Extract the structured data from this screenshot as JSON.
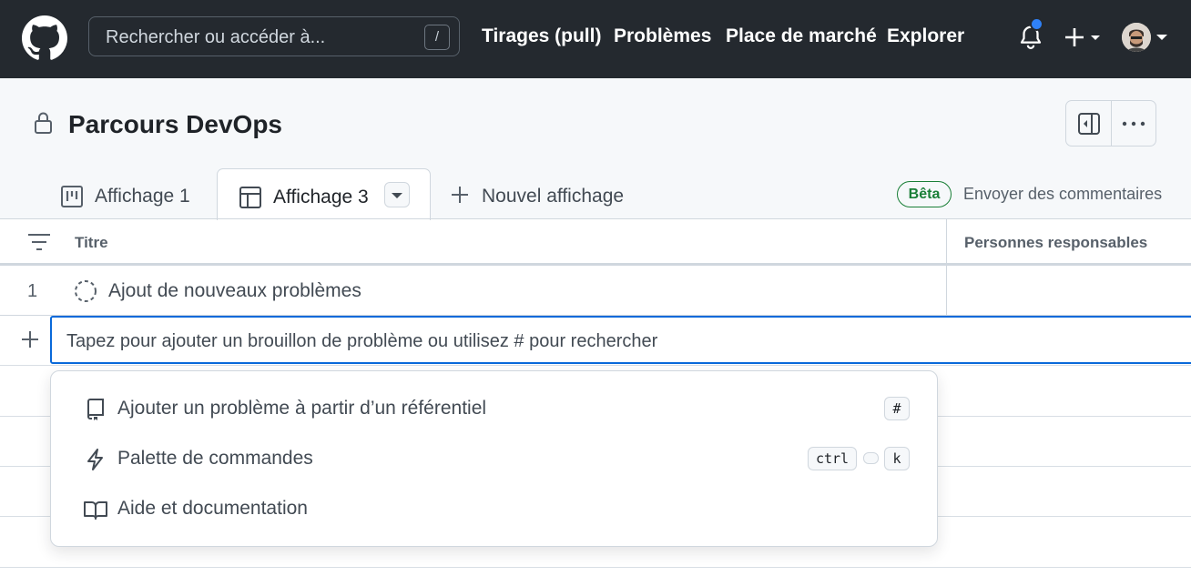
{
  "header": {
    "logo": "github-logo",
    "search_placeholder": "Rechercher ou accéder à...",
    "search_shortcut": "/",
    "nav": [
      "Tirages (pull)",
      "Problèmes",
      "Place de marché",
      "Explorer"
    ],
    "notification_color": "#2f81f7"
  },
  "project": {
    "title": "Parcours DevOps",
    "visibility_icon": "lock-icon"
  },
  "tabs": [
    {
      "label": "Affichage 1",
      "icon": "board-icon",
      "active": false
    },
    {
      "label": "Affichage 3",
      "icon": "table-icon",
      "active": true
    },
    {
      "label": "Nouvel affichage",
      "icon": "plus-icon",
      "active": false
    }
  ],
  "beta_label": "Bêta",
  "feedback_label": "Envoyer des commentaires",
  "table": {
    "columns": [
      "Titre",
      "Personnes responsables"
    ],
    "rows": [
      {
        "number": "1",
        "title": "Ajout de nouveaux problèmes",
        "status_icon": "draft-issue-icon"
      }
    ],
    "add_placeholder": "Tapez pour ajouter un brouillon de problème ou utilisez # pour rechercher"
  },
  "menu": {
    "items": [
      {
        "label": "Ajouter un problème à partir d’un référentiel",
        "icon": "repo-icon",
        "shortcut": [
          "#"
        ]
      },
      {
        "label": "Palette de commandes",
        "icon": "zap-icon",
        "shortcut": [
          "ctrl",
          "k"
        ]
      },
      {
        "label": "Aide et documentation",
        "icon": "book-icon",
        "shortcut": []
      }
    ]
  },
  "colors": {
    "header_bg": "#24292f",
    "accent": "#0969da",
    "beta_green": "#1a7f37"
  }
}
